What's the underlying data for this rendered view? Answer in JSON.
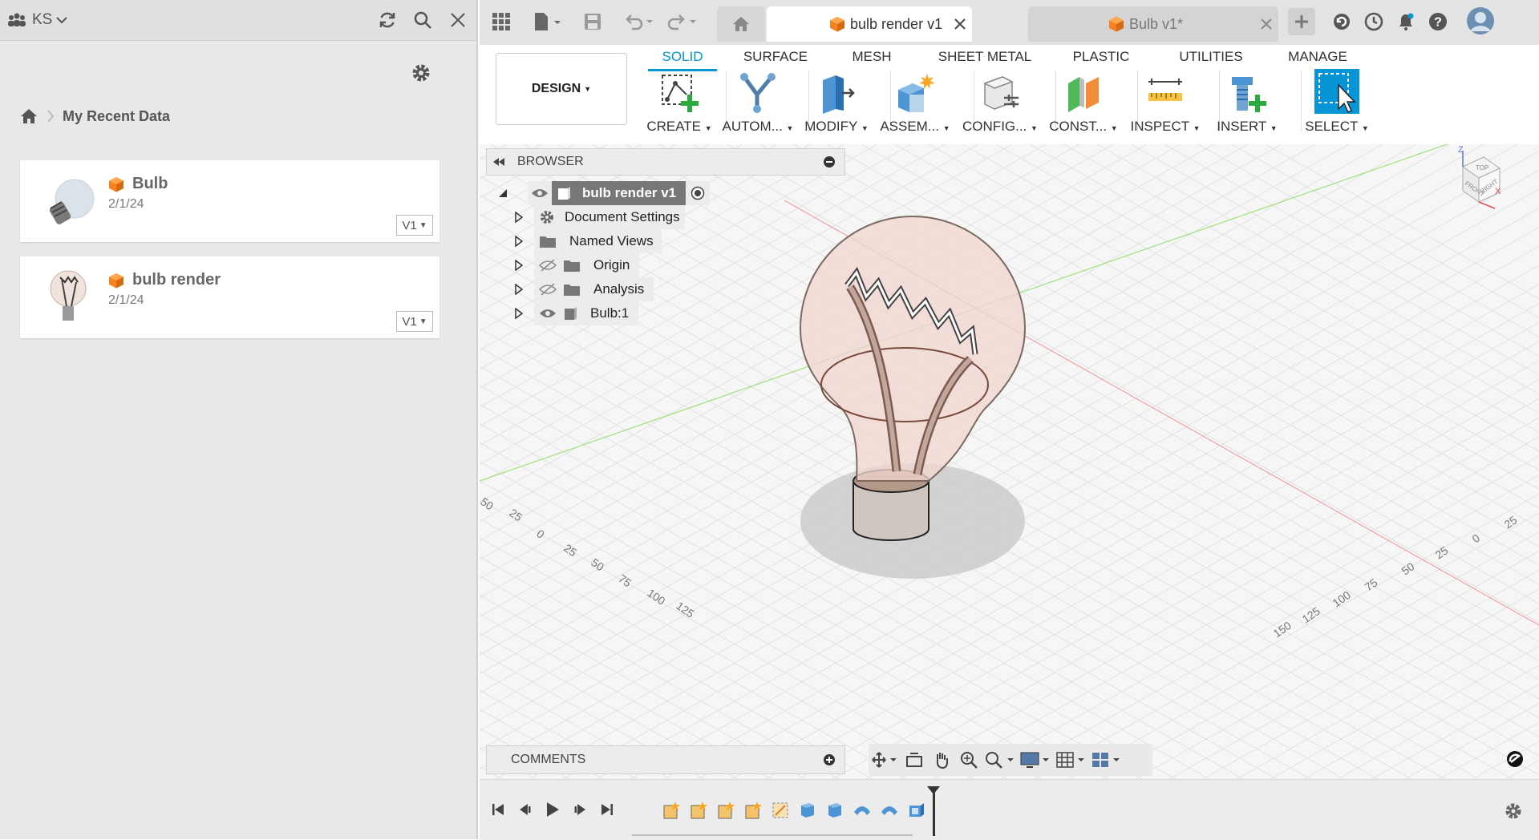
{
  "left_panel": {
    "team_label": "KS",
    "breadcrumb": "My Recent Data",
    "items": [
      {
        "name": "Bulb",
        "date": "2/1/24",
        "version": "V1"
      },
      {
        "name": "bulb render",
        "date": "2/1/24",
        "version": "V1"
      }
    ]
  },
  "tabs": [
    {
      "label": "bulb render v1",
      "active": true
    },
    {
      "label": "Bulb v1*",
      "active": false
    }
  ],
  "design_button": "DESIGN",
  "workspace_tabs": [
    "SOLID",
    "SURFACE",
    "MESH",
    "SHEET METAL",
    "PLASTIC",
    "UTILITIES",
    "MANAGE"
  ],
  "tools": [
    "CREATE",
    "AUTOM...",
    "MODIFY",
    "ASSEM...",
    "CONFIG...",
    "CONST...",
    "INSPECT",
    "INSERT",
    "SELECT"
  ],
  "browser": {
    "title": "BROWSER",
    "root": "bulb render v1",
    "nodes": [
      "Document Settings",
      "Named Views",
      "Origin",
      "Analysis",
      "Bulb:1"
    ]
  },
  "comments_label": "COMMENTS",
  "viewcube": {
    "top": "TOP",
    "front": "FRONT",
    "right": "RIGHT",
    "z": "Z",
    "x": "X"
  },
  "grid_labels": {
    "left": [
      "50",
      "25",
      "0",
      "25",
      "50",
      "75",
      "100",
      "125"
    ],
    "right": [
      "25",
      "0",
      "25",
      "50",
      "75",
      "100",
      "125",
      "150"
    ]
  },
  "colors": {
    "accent": "#0696d7",
    "brand_orange": "#f58220"
  }
}
